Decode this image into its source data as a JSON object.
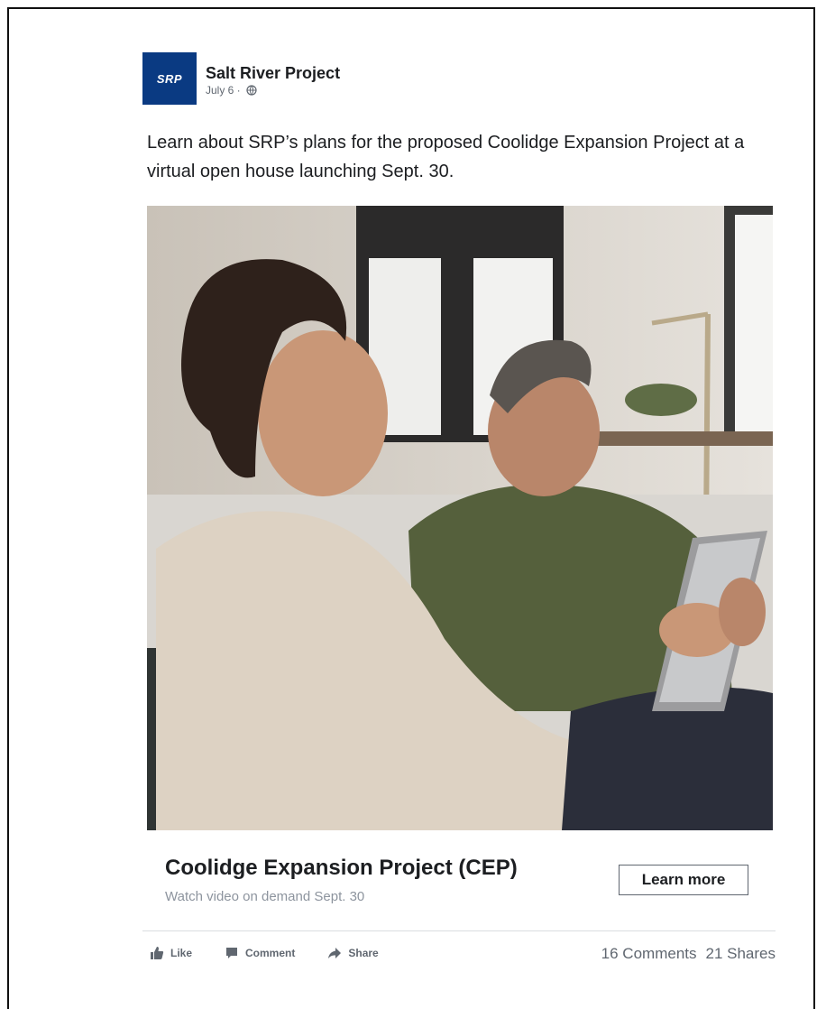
{
  "post": {
    "page_name": "Salt River Project",
    "logo_text": "SRP",
    "date": "July 6 ·",
    "message": "Learn about SRP’s plans for the proposed Coolidge Expansion Project at a virtual open house launching Sept. 30.",
    "link_title": "Coolidge Expansion Project (CEP)",
    "link_subtitle": "Watch video on demand Sept. 30",
    "cta_label": "Learn more",
    "actions": [
      {
        "label": "Like",
        "icon": "thumbs-up-icon"
      },
      {
        "label": "Comment",
        "icon": "comment-icon"
      },
      {
        "label": "Share",
        "icon": "share-icon"
      }
    ],
    "comments_count": "16 Comments",
    "shares_count": "21 Shares"
  },
  "colors": {
    "brand": "#0a3a82",
    "text": "#1c1e21",
    "muted": "#606770"
  }
}
